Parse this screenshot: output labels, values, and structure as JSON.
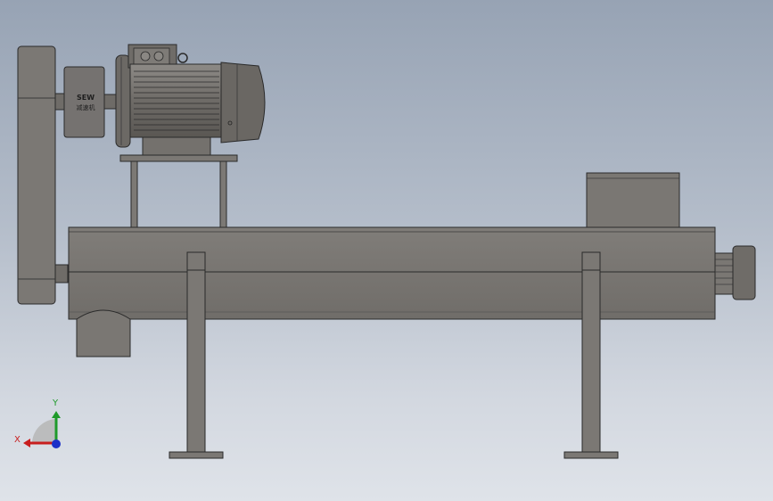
{
  "viewport": {
    "background_top": "#97a3b4",
    "background_bottom": "#dfe3e9",
    "part_color": "#7a7773",
    "edge_color": "#2a2a2a"
  },
  "gearbox": {
    "brand_label": "SEW",
    "type_label": "减速机"
  },
  "triad": {
    "x_label": "X",
    "y_label": "Y",
    "x_color": "#c81e1e",
    "y_color": "#1f9a2a",
    "z_color": "#1c2fc8"
  }
}
